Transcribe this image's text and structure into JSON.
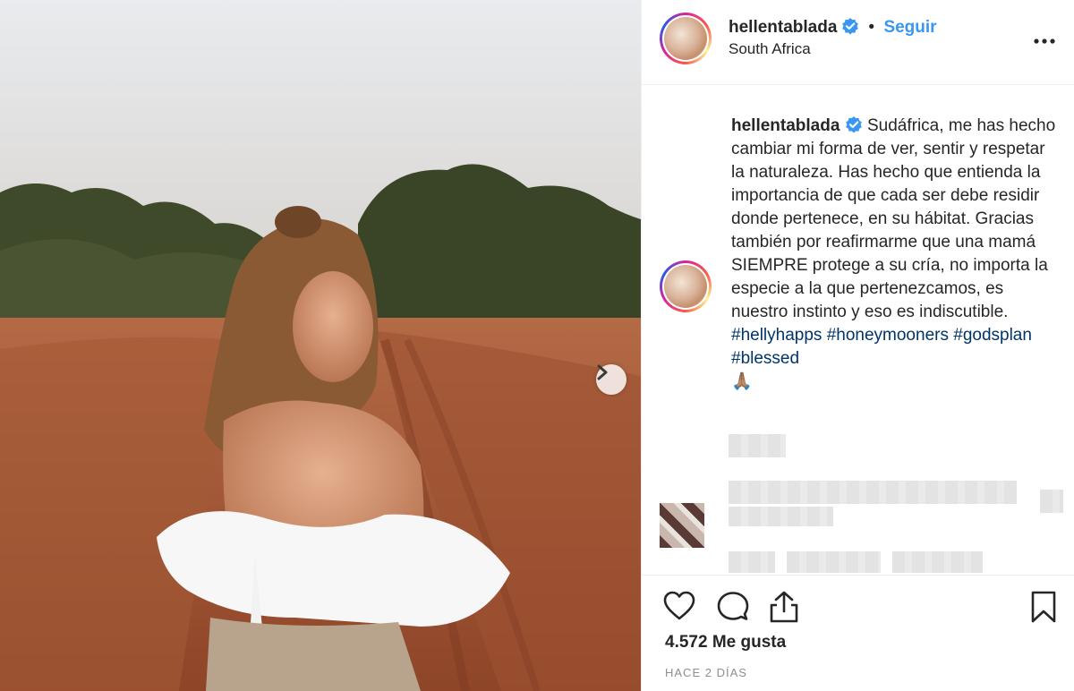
{
  "post": {
    "username": "hellentablada",
    "follow_label": "Seguir",
    "separator": "•",
    "location": "South Africa",
    "caption_text": "Sudáfrica, me has hecho cambiar mi forma de ver, sentir y respetar la naturaleza. Has hecho que entienda la importancia de que cada ser debe residir donde pertenece, en su hábitat. Gracias también por reafirmarme que una mamá SIEMPRE protege a su cría, no importa la especie a la que pertenezcamos, es nuestro instinto y eso es indiscutible.",
    "hashtags": [
      "#hellyhapps",
      "#honeymooners",
      "#godsplan",
      "#blessed"
    ],
    "emoji": "🙏🏽",
    "likes": "4.572 Me gusta",
    "time": "HACE 2 DÍAS"
  },
  "icons": {
    "verified": "verified-badge-icon",
    "more": "more-options-icon",
    "next": "chevron-right-icon",
    "like": "heart-icon",
    "comment": "comment-icon",
    "share": "share-icon",
    "save": "bookmark-icon"
  },
  "colors": {
    "link": "#3897f0",
    "hashtag": "#003569",
    "verified": "#3897f0",
    "muted": "#8e8e8e"
  }
}
